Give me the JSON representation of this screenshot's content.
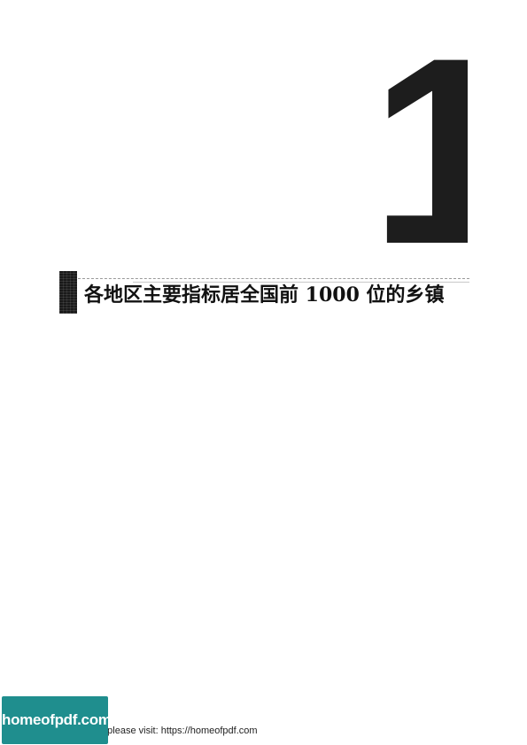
{
  "chapter": {
    "number": "1",
    "title": "各地区主要指标居全国前 1000 位的乡镇"
  },
  "footer": {
    "notice": "e please visit: https://homeofpdf.com"
  },
  "logo": {
    "text": "homeofpdf.com"
  },
  "colors": {
    "text": "#111111",
    "logo_background": "#1f8e8e"
  }
}
